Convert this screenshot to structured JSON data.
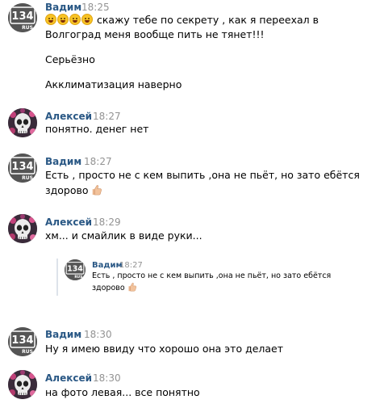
{
  "messages": [
    {
      "author": "Вадим",
      "time": "18:25",
      "avatar": "134-rus-logo",
      "lines": [
        "скажу тебе по секрету , как я переехал в",
        "Волгоград меня вообще пить не тянет!!!"
      ],
      "emojis": [
        "laughing-crying-emoji",
        "laughing-crying-emoji",
        "grinning-emoji",
        "laughing-crying-emoji"
      ],
      "extra": [
        "Серьёзно",
        "Акклиматизация наверно"
      ]
    },
    {
      "author": "Алексей",
      "time": "18:27",
      "avatar": "skull-icon",
      "lines": [
        "понятно. денег нет"
      ]
    },
    {
      "author": "Вадим",
      "time": "18:27",
      "avatar": "134-rus-logo",
      "lines": [
        "Есть , просто не с кем выпить ,она не пьёт, но зато ебётся",
        "здорово"
      ]
    },
    {
      "author": "Алексей",
      "time": "18:29",
      "avatar": "skull-icon",
      "lines": [
        "хм... и смайлик в виде руки..."
      ],
      "forwarded": {
        "author": "Вадим",
        "time": "18:27",
        "lines": [
          "Есть , просто не с кем выпить ,она не пьёт, но зато ебётся",
          "здорово"
        ]
      }
    },
    {
      "author": "Вадим",
      "time": "18:30",
      "avatar": "134-rus-logo",
      "lines": [
        "Ну я имею ввиду что хорошо она это делает"
      ]
    },
    {
      "author": "Алексей",
      "time": "18:30",
      "avatar": "skull-icon",
      "lines": [
        "на фото левая... все понятно"
      ]
    }
  ],
  "logo_text": {
    "number": "134",
    "sub": "RUS"
  },
  "colors": {
    "author": "#2a5885",
    "time": "#939393",
    "text": "#000000",
    "divider": "#dde3ea"
  }
}
